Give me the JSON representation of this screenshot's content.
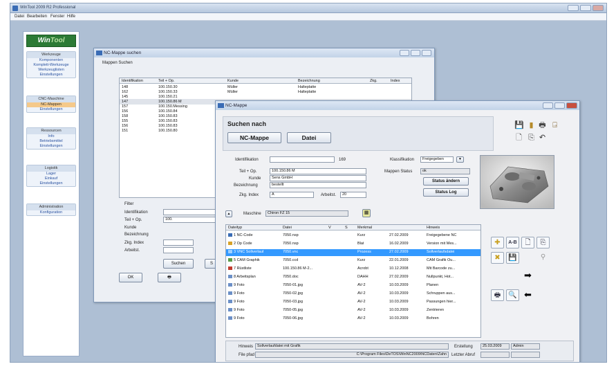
{
  "window_title": "WinTool 2009 R2 Professional",
  "menu": [
    "Datei",
    "Bearbeiten",
    "Fenster",
    "Hilfe"
  ],
  "logo": {
    "a": "Win",
    "b": "Tool"
  },
  "sidebar": [
    {
      "header": "Werkzeuge",
      "items": [
        "Komponenten",
        "Komplett-Werkzeuge",
        "Werkzeuglisten",
        "Einstellungen"
      ]
    },
    {
      "header": "CNC-Maschine",
      "items": [
        "NC-Mappen",
        "Einstellungen"
      ],
      "selected": 0
    },
    {
      "header": "Ressourcen",
      "items": [
        "Info",
        "Betriebsmittel",
        "Einstellungen"
      ]
    },
    {
      "header": "Logistik",
      "items": [
        "Lager",
        "Einkauf",
        "Einstellungen"
      ]
    },
    {
      "header": "Administration",
      "items": [
        "Konfiguration"
      ]
    }
  ],
  "search": {
    "title": "NC-Mappe suchen",
    "tab": "Mappen Suchen",
    "columns": [
      "Identifikation",
      "Teil + Op.",
      "Kunde",
      "Bezeichnung",
      "Zkg.",
      "Index"
    ],
    "rows": [
      [
        "148",
        "100.150.30",
        "Müller",
        "Halteplatte"
      ],
      [
        "162",
        "100.150.33",
        "Müller",
        "Halteplatte"
      ],
      [
        "145",
        "100.150.21",
        "",
        ""
      ],
      [
        "147",
        "100.150.86 M",
        "",
        ""
      ],
      [
        "157",
        "100.150.Messing",
        "",
        ""
      ],
      [
        "156",
        "100.150.84",
        "",
        ""
      ],
      [
        "158",
        "100.150.83",
        "",
        ""
      ],
      [
        "155",
        "100.150.83",
        "",
        ""
      ],
      [
        "156",
        "100.150.83",
        "",
        ""
      ],
      [
        "151",
        "100.150.80",
        "",
        ""
      ]
    ],
    "filter_title": "Filter",
    "filter_labels": [
      "Identifikation",
      "Teil + Op.",
      "Kunde",
      "Bezeichnung",
      "Zkg. Index",
      "Arbeitst."
    ],
    "filter_teil_value": "100.",
    "btn_suchen": "Suchen",
    "btn_s": "S",
    "btn_ok": "OK"
  },
  "nc": {
    "title": "NC-Mappe",
    "heading": "Suchen nach",
    "btn_mappe": "NC-Mappe",
    "btn_datei": "Datei",
    "ident_label": "Identifikation",
    "ident_value": "169",
    "teil_label": "Teil + Op.",
    "teil_value": "100.150.86 M",
    "kunde_label": "Kunde",
    "kunde_value": "Sens GmbH",
    "bez_label": "Bezeichnung",
    "bez_value": "bestellt",
    "zkg_label": "Zkg. Index",
    "zkg_value": "A",
    "arbeit_label": "Arbeitst.",
    "arbeit_value": "20",
    "klass_label": "Klassifikation",
    "klass_value": "Freigegeben",
    "status_label": "Mappen Status",
    "status_value": "ok",
    "btn_status": "Status ändern",
    "btn_log": "Status Log",
    "maschine_label": "Maschine",
    "maschine_value": "Chiron FZ 15",
    "file_cols": [
      "Dateityp",
      "Datei",
      "V",
      "S",
      "Merkmal",
      "",
      "Hinweis"
    ],
    "files": [
      [
        "1 NC-Code",
        "7050.nsp",
        "Kurz",
        "27.02.2009",
        "Freigegebene NC"
      ],
      [
        "2 Op Code",
        "7050.nsp",
        "Blat",
        "16.02.2009",
        "Version mit Mes..."
      ],
      [
        "3 VNC Sollverlauf",
        "7050.vnc",
        "Prozess",
        "27.02.2009",
        "Sollverlaufsdatei"
      ],
      [
        "5 CAM Graphik",
        "7050.ccd",
        "Kurz",
        "22.01.2009",
        "CAM Grafik Ou..."
      ],
      [
        "7 Rüstliste",
        "100.150.86 M-2...",
        "Acrobt",
        "10.12.2008",
        "Mit Barcode zu..."
      ],
      [
        "8 Arbeitsplan",
        "7050.doc",
        "DAHH",
        "27.02.2009",
        "Nullpunkt, Hot..."
      ],
      [
        "9 Foto",
        "7050-01.jpg",
        "AV-2",
        "10.03.2009",
        "Planen"
      ],
      [
        "9 Foto",
        "7050-02.jpg",
        "AV-2",
        "10.03.2009",
        "Schruppen aus..."
      ],
      [
        "9 Foto",
        "7050-03.jpg",
        "AV-2",
        "10.03.2009",
        "Passungen hier..."
      ],
      [
        "9 Foto",
        "7050-05.jpg",
        "AV-2",
        "10.03.2009",
        "Zentrieren"
      ],
      [
        "9 Foto",
        "7050-06.jpg",
        "AV-2",
        "10.03.2009",
        "Bohren"
      ]
    ],
    "selected_file": 2,
    "hinweis_label": "Hinweis",
    "hinweis_value": "Sollverlaufdatei mit Grafik",
    "file_label": "File pfad",
    "file_value": "C:\\Program Files\\DeTOS\\WinNC2009\\NCDaten\\Zahn",
    "erstellung_label": "Erstellung",
    "erstellung_date": "25.03.2009",
    "erstellung_user": "Admin",
    "letzter_label": "Letzter Abruf"
  },
  "colors": {
    "selection": "#3399ff",
    "accent": "#2c7a35",
    "desktop": "#aebfd4"
  }
}
